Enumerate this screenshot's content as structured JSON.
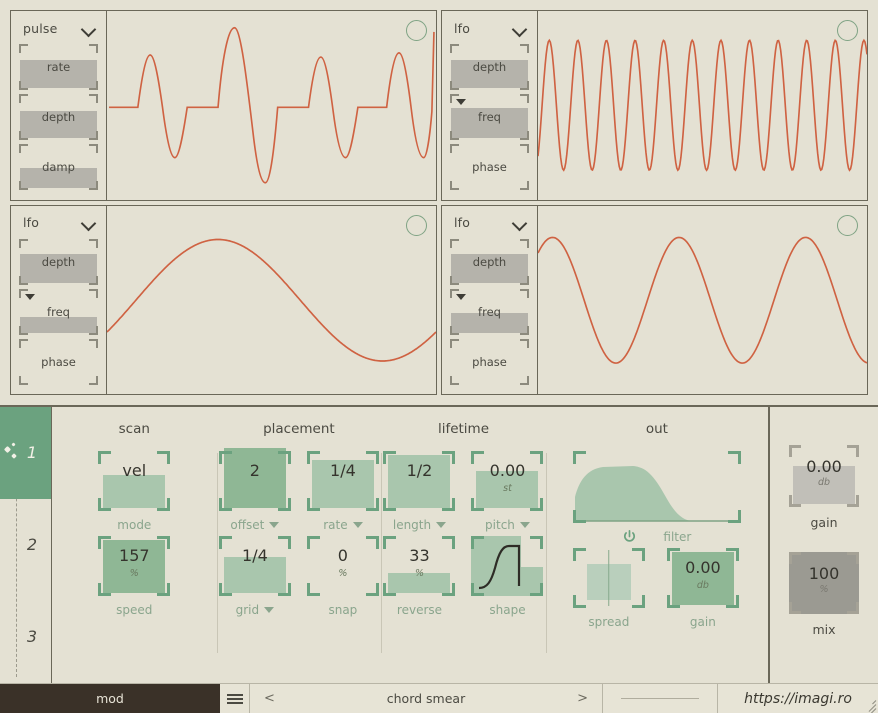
{
  "mod_panels": [
    {
      "title": "pulse",
      "icon": "chevron-down-icon",
      "power_icon": "power-circle-icon",
      "slots": [
        {
          "label": "rate",
          "fill": 62
        },
        {
          "label": "depth",
          "fill": 60
        },
        {
          "label": "damp",
          "fill": 45
        }
      ],
      "wave": "pulse"
    },
    {
      "title": "lfo",
      "icon": "chevron-down-icon",
      "power_icon": "power-circle-icon",
      "slots": [
        {
          "label": "depth",
          "fill": 60
        },
        {
          "label": "freq",
          "fill": 66,
          "marker": true
        },
        {
          "label": "phase",
          "fill": 0
        }
      ],
      "wave": "sine-fast"
    },
    {
      "title": "lfo",
      "icon": "chevron-down-icon",
      "power_icon": "power-circle-icon",
      "slots": [
        {
          "label": "depth",
          "fill": 62
        },
        {
          "label": "freq",
          "fill": 34,
          "marker": true
        },
        {
          "label": "phase",
          "fill": 0
        }
      ],
      "wave": "sine-slow"
    },
    {
      "title": "lfo",
      "icon": "chevron-down-icon",
      "power_icon": "power-circle-icon",
      "slots": [
        {
          "label": "depth",
          "fill": 62
        },
        {
          "label": "freq",
          "fill": 44,
          "marker": true
        },
        {
          "label": "phase",
          "fill": 0
        }
      ],
      "wave": "sine-mid"
    }
  ],
  "lanes": [
    {
      "label": "1",
      "active": true,
      "icon": "particles-icon"
    },
    {
      "label": "2",
      "active": false
    },
    {
      "label": "3",
      "active": false
    }
  ],
  "groups": {
    "scan": {
      "title": "scan",
      "controls": [
        {
          "name": "mode",
          "value": "vel",
          "unit": "",
          "caption": "mode",
          "fill": 55,
          "dropdown": false,
          "dark": false
        },
        {
          "name": "speed",
          "value": "157",
          "unit": "%",
          "caption": "speed",
          "fill": 88,
          "dropdown": false,
          "dark": true
        }
      ]
    },
    "placement": {
      "title": "placement",
      "controls": [
        {
          "name": "offset",
          "value": "2",
          "unit": "",
          "caption": "offset",
          "fill": 100,
          "dropdown": true,
          "dark": true
        },
        {
          "name": "rate",
          "value": "1/4",
          "unit": "",
          "caption": "rate",
          "fill": 80,
          "dropdown": true,
          "dark": false
        },
        {
          "name": "grid",
          "value": "1/4",
          "unit": "",
          "caption": "grid",
          "fill": 60,
          "dropdown": true,
          "dark": false
        },
        {
          "name": "snap",
          "value": "0",
          "unit": "%",
          "caption": "snap",
          "fill": 0,
          "dropdown": false,
          "dark": false
        }
      ]
    },
    "lifetime": {
      "title": "lifetime",
      "controls": [
        {
          "name": "length",
          "value": "1/2",
          "unit": "",
          "caption": "length",
          "fill": 88,
          "dropdown": true,
          "dark": false
        },
        {
          "name": "pitch",
          "value": "0.00",
          "unit": "st",
          "caption": "pitch",
          "fill": 62,
          "dropdown": true,
          "dark": false
        },
        {
          "name": "reverse",
          "value": "33",
          "unit": "%",
          "caption": "reverse",
          "fill": 33,
          "dropdown": false,
          "dark": false
        },
        {
          "name": "shape",
          "value": "",
          "unit": "",
          "caption": "shape",
          "fill": 60,
          "dropdown": false,
          "dark": true
        }
      ]
    },
    "out": {
      "title": "out",
      "filter_caption": "filter",
      "filter_power_icon": "power-icon",
      "controls": [
        {
          "name": "spread",
          "value": "",
          "unit": "",
          "caption": "spread",
          "fill": 52,
          "dropdown": false,
          "dark": false
        },
        {
          "name": "gain",
          "value": "0.00",
          "unit": "db",
          "caption": "gain",
          "fill": 88,
          "dropdown": false,
          "dark": true
        }
      ]
    }
  },
  "rightcol": {
    "gain": {
      "value": "0.00",
      "unit": "db",
      "caption": "gain"
    },
    "mix": {
      "value": "100",
      "unit": "%",
      "caption": "mix"
    }
  },
  "statusbar": {
    "mod_label": "mod",
    "menu_icon": "hamburger-icon",
    "prev_icon": "<",
    "preset_name": "chord smear",
    "next_icon": ">",
    "url": "https://imagi.ro",
    "resize_icon": "resize-grip-icon"
  },
  "colors": {
    "bg": "#e4e1d3",
    "wave": "#cf6242",
    "accent_green": "#6ba27f",
    "fill_green_light": "#a9c6ad",
    "fill_green_dark": "#8fb795",
    "slider_gray": "#b5b3ab",
    "dark_bar": "#3a3128",
    "text": "#4b4a42"
  }
}
